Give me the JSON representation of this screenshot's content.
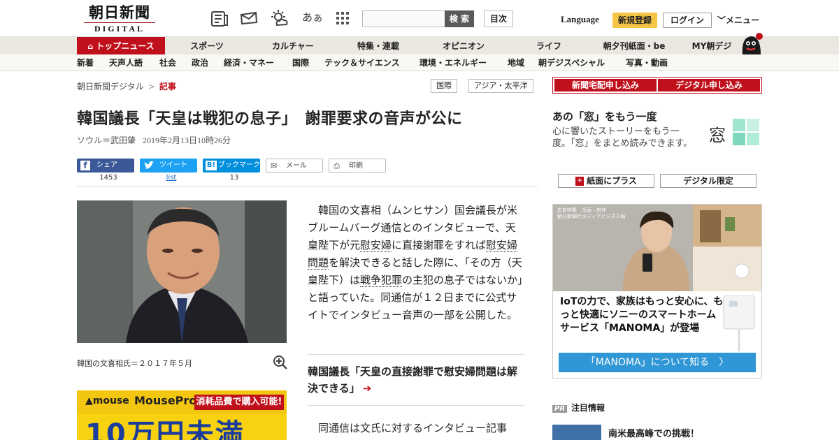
{
  "header": {
    "logo_jp": "朝日新聞",
    "logo_en": "DIGITAL",
    "search_button": "検 索",
    "mokuji": "目次",
    "language": "Language",
    "signup": "新規登録",
    "login": "ログイン",
    "menu": "メニュー",
    "hiragana_icon_label": "あぁ"
  },
  "nav_primary": [
    {
      "label": "トップニュース"
    },
    {
      "label": "スポーツ"
    },
    {
      "label": "カルチャー"
    },
    {
      "label": "特集・連載"
    },
    {
      "label": "オピニオン"
    },
    {
      "label": "ライフ"
    },
    {
      "label": "朝夕刊紙面・be"
    },
    {
      "label": "MY朝デジ"
    }
  ],
  "nav_secondary": [
    {
      "label": "新着"
    },
    {
      "label": "天声人語"
    },
    {
      "label": "社会"
    },
    {
      "label": "政治"
    },
    {
      "label": "経済・マネー"
    },
    {
      "label": "国際"
    },
    {
      "label": "テック＆サイエンス"
    },
    {
      "label": "環境・エネルギー"
    },
    {
      "label": "地域"
    },
    {
      "label": "朝デジスペシャル"
    },
    {
      "label": "写真・動画"
    }
  ],
  "breadcrumb": {
    "home": "朝日新聞デジタル",
    "sep": ">",
    "current": "記事"
  },
  "tags": [
    "国際",
    "アジア・太平洋"
  ],
  "article": {
    "title": "韓国議長「天皇は戦犯の息子」　謝罪要求の音声が公に",
    "author": "ソウル＝武田肇",
    "date": "2019年2月13日10時26分",
    "caption": "韓国の文喜相氏＝２０１７年５月",
    "body_parts": [
      "韓国の文喜相（ムンヒサン）国会議長が米ブルームバーグ通信とのインタビューで、天皇陛下が元",
      "慰安婦",
      "に直接謝罪をすれば",
      "慰安婦問題",
      "を解決できると話した際に、「その方（天皇陛下）は",
      "戦争犯罪",
      "の主犯の息子ではないか」と語っていた。同通信が１２日までに公式サイトでインタビュー音声の一部を公開した。"
    ],
    "related": "韓国議長「天皇の直接謝罪で慰安婦問題は解決できる」",
    "body2": "同通信は文氏に対するインタビュー記事"
  },
  "share": {
    "facebook": {
      "label": "シェア",
      "count": "1453"
    },
    "twitter": {
      "label": "ツイート",
      "count": "list"
    },
    "hatena": {
      "label": "ブックマーク",
      "count": "13"
    },
    "mail": {
      "label": "メール"
    },
    "print": {
      "label": "印刷"
    }
  },
  "sidebar": {
    "subscribe_home": "新聞宅配申し込み",
    "subscribe_digital": "デジタル申し込み",
    "mado_title": "あの「窓」をもう一度",
    "mado_desc": "心に響いたストーリーをもう一度。「窓」をまとめ読みできます。",
    "mado_kanji": "窓",
    "plus_button": "紙面にプラス",
    "digital_only": "デジタル限定",
    "pr_badge": "PR",
    "pr_title": "注目情報",
    "pr_item": "南米最高峰での挑戦！"
  },
  "ad_left": {
    "brand": "mouse",
    "brand2": "MousePro",
    "campaign": "消耗品費で購入可能!",
    "headline": "10万円未満"
  },
  "ad_right": {
    "header_line1": "広告特集　企画・制作",
    "header_line2": "朝日新聞社メディアビジネス局",
    "text": "IoTの力で、家族はもっと安心に、もっと快適にソニーのスマートホームサービス「MANOMA」が登場",
    "button": "「MANOMA」について知る　〉"
  },
  "colors": {
    "brand_red": "#c0101c",
    "signup_yellow": "#f5c545",
    "facebook": "#3b5998",
    "twitter": "#1da1f2",
    "hatena": "#008fde"
  }
}
